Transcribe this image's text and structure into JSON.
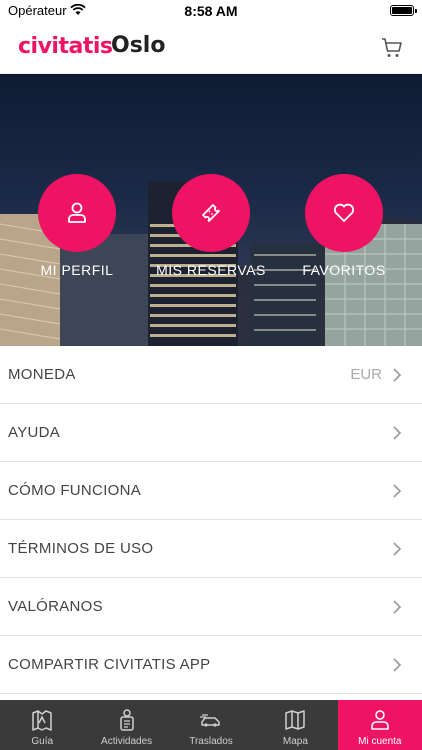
{
  "status_bar": {
    "carrier": "Opérateur",
    "time": "8:58 AM"
  },
  "header": {
    "brand": "civitatis",
    "city": "Oslo"
  },
  "hero": {
    "actions": [
      {
        "label": "MI PERFIL",
        "icon": "user-icon"
      },
      {
        "label": "MIS RESERVAS",
        "icon": "ticket-icon"
      },
      {
        "label": "FAVORITOS",
        "icon": "heart-icon"
      }
    ]
  },
  "menu": {
    "items": [
      {
        "label": "MONEDA",
        "value": "EUR"
      },
      {
        "label": "AYUDA"
      },
      {
        "label": "CÓMO FUNCIONA"
      },
      {
        "label": "TÉRMINOS DE USO"
      },
      {
        "label": "VALÓRANOS"
      },
      {
        "label": "COMPARTIR CIVITATIS APP"
      }
    ]
  },
  "tab_bar": {
    "tabs": [
      {
        "label": "Guía",
        "icon": "guide-book-icon"
      },
      {
        "label": "Actividades",
        "icon": "activities-icon"
      },
      {
        "label": "Traslados",
        "icon": "transfer-car-icon"
      },
      {
        "label": "Mapa",
        "icon": "map-icon"
      },
      {
        "label": "Mi cuenta",
        "icon": "account-icon",
        "active": true
      }
    ]
  },
  "colors": {
    "brand": "#ee1463",
    "tab_bar": "#3a3a3a"
  }
}
